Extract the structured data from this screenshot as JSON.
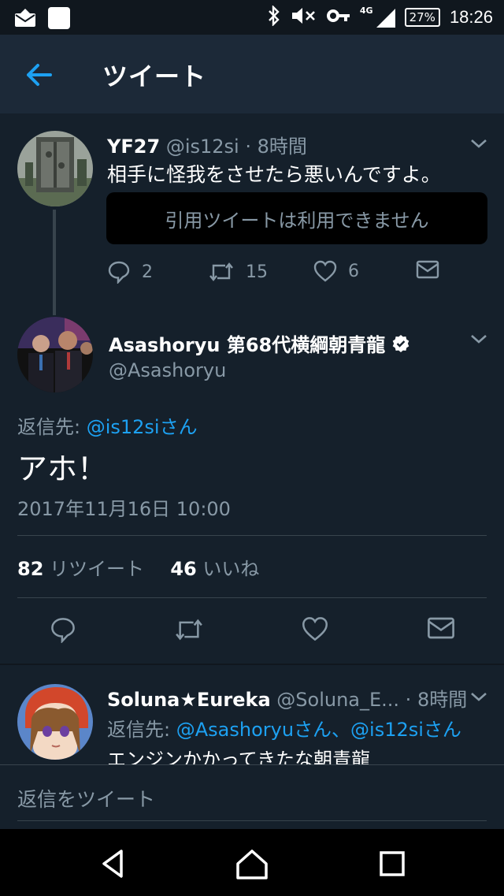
{
  "status_bar": {
    "time": "18:26",
    "battery": "27%",
    "network": "4G"
  },
  "app_bar": {
    "title": "ツイート"
  },
  "tweet1": {
    "name": "YF27",
    "handle": "@is12si",
    "sep": " · ",
    "time": "8時間",
    "text": "相手に怪我をさせたら悪いんですよ。",
    "quote_unavailable": "引用ツイートは利用できません",
    "replies": "2",
    "retweets": "15",
    "likes": "6"
  },
  "main_tweet": {
    "name": "Asashoryu 第68代横綱朝青龍",
    "handle": "@Asashoryu",
    "reply_prefix": "返信先: ",
    "reply_to": "@is12siさん",
    "body": "アホ！",
    "date": "2017年11月16日 10:00",
    "retweet_count": "82",
    "retweet_label": " リツイート",
    "like_count": "46",
    "like_label": " いいね"
  },
  "tweet3": {
    "name": "Soluna★Eureka",
    "handle": "@Soluna_E...",
    "sep": " · ",
    "time": "8時間",
    "reply_prefix": "返信先: ",
    "reply_to_1": "@Asashoryuさん",
    "reply_join": "、",
    "reply_to_2": "@is12siさん",
    "text": "エンジンかかってきたな朝青龍"
  },
  "reply_bar": {
    "placeholder": "返信をツイート"
  },
  "colors": {
    "background": "#15202b",
    "accent": "#1da1f2",
    "muted": "#8899a6"
  }
}
